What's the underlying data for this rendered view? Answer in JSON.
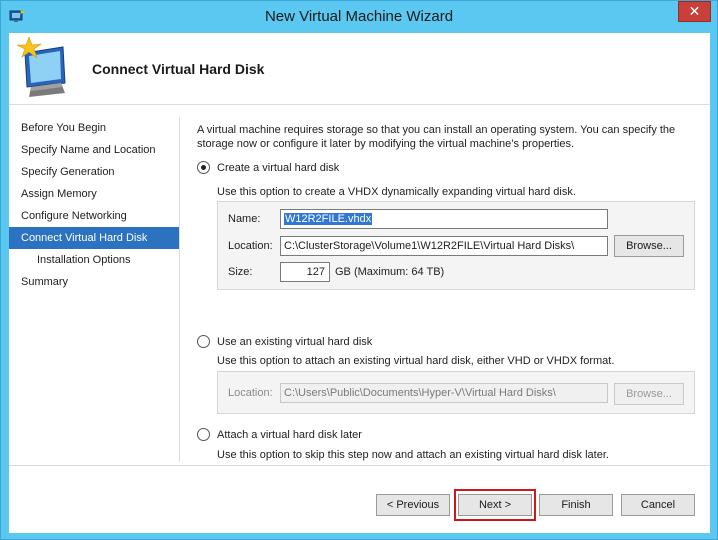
{
  "window": {
    "title": "New Virtual Machine Wizard",
    "close_label": "✕"
  },
  "header": {
    "title": "Connect Virtual Hard Disk"
  },
  "sidebar": {
    "items": [
      {
        "label": "Before You Begin"
      },
      {
        "label": "Specify Name and Location"
      },
      {
        "label": "Specify Generation"
      },
      {
        "label": "Assign Memory"
      },
      {
        "label": "Configure Networking"
      },
      {
        "label": "Connect Virtual Hard Disk"
      },
      {
        "label": "Installation Options"
      },
      {
        "label": "Summary"
      }
    ]
  },
  "main": {
    "intro": "A virtual machine requires storage so that you can install an operating system. You can specify the storage now or configure it later by modifying the virtual machine’s properties.",
    "create": {
      "label": "Create a virtual hard disk",
      "desc": "Use this option to create a VHDX dynamically expanding virtual hard disk.",
      "name_label": "Name:",
      "name_value": "W12R2FILE.vhdx",
      "location_label": "Location:",
      "location_value": "C:\\ClusterStorage\\Volume1\\W12R2FILE\\Virtual Hard Disks\\",
      "browse_label": "Browse...",
      "size_label": "Size:",
      "size_value": "127",
      "size_unit": "GB (Maximum: 64 TB)"
    },
    "existing": {
      "label": "Use an existing virtual hard disk",
      "desc": "Use this option to attach an existing virtual hard disk, either VHD or VHDX format.",
      "location_label": "Location:",
      "location_value": "C:\\Users\\Public\\Documents\\Hyper-V\\Virtual Hard Disks\\",
      "browse_label": "Browse..."
    },
    "later": {
      "label": "Attach a virtual hard disk later",
      "desc": "Use this option to skip this step now and attach an existing virtual hard disk later."
    }
  },
  "footer": {
    "previous_label": "< Previous",
    "next_label": "Next >",
    "finish_label": "Finish",
    "cancel_label": "Cancel"
  },
  "colors": {
    "frame": "#5ac8f0",
    "selection": "#2b72c1",
    "highlight": "#d01818"
  }
}
